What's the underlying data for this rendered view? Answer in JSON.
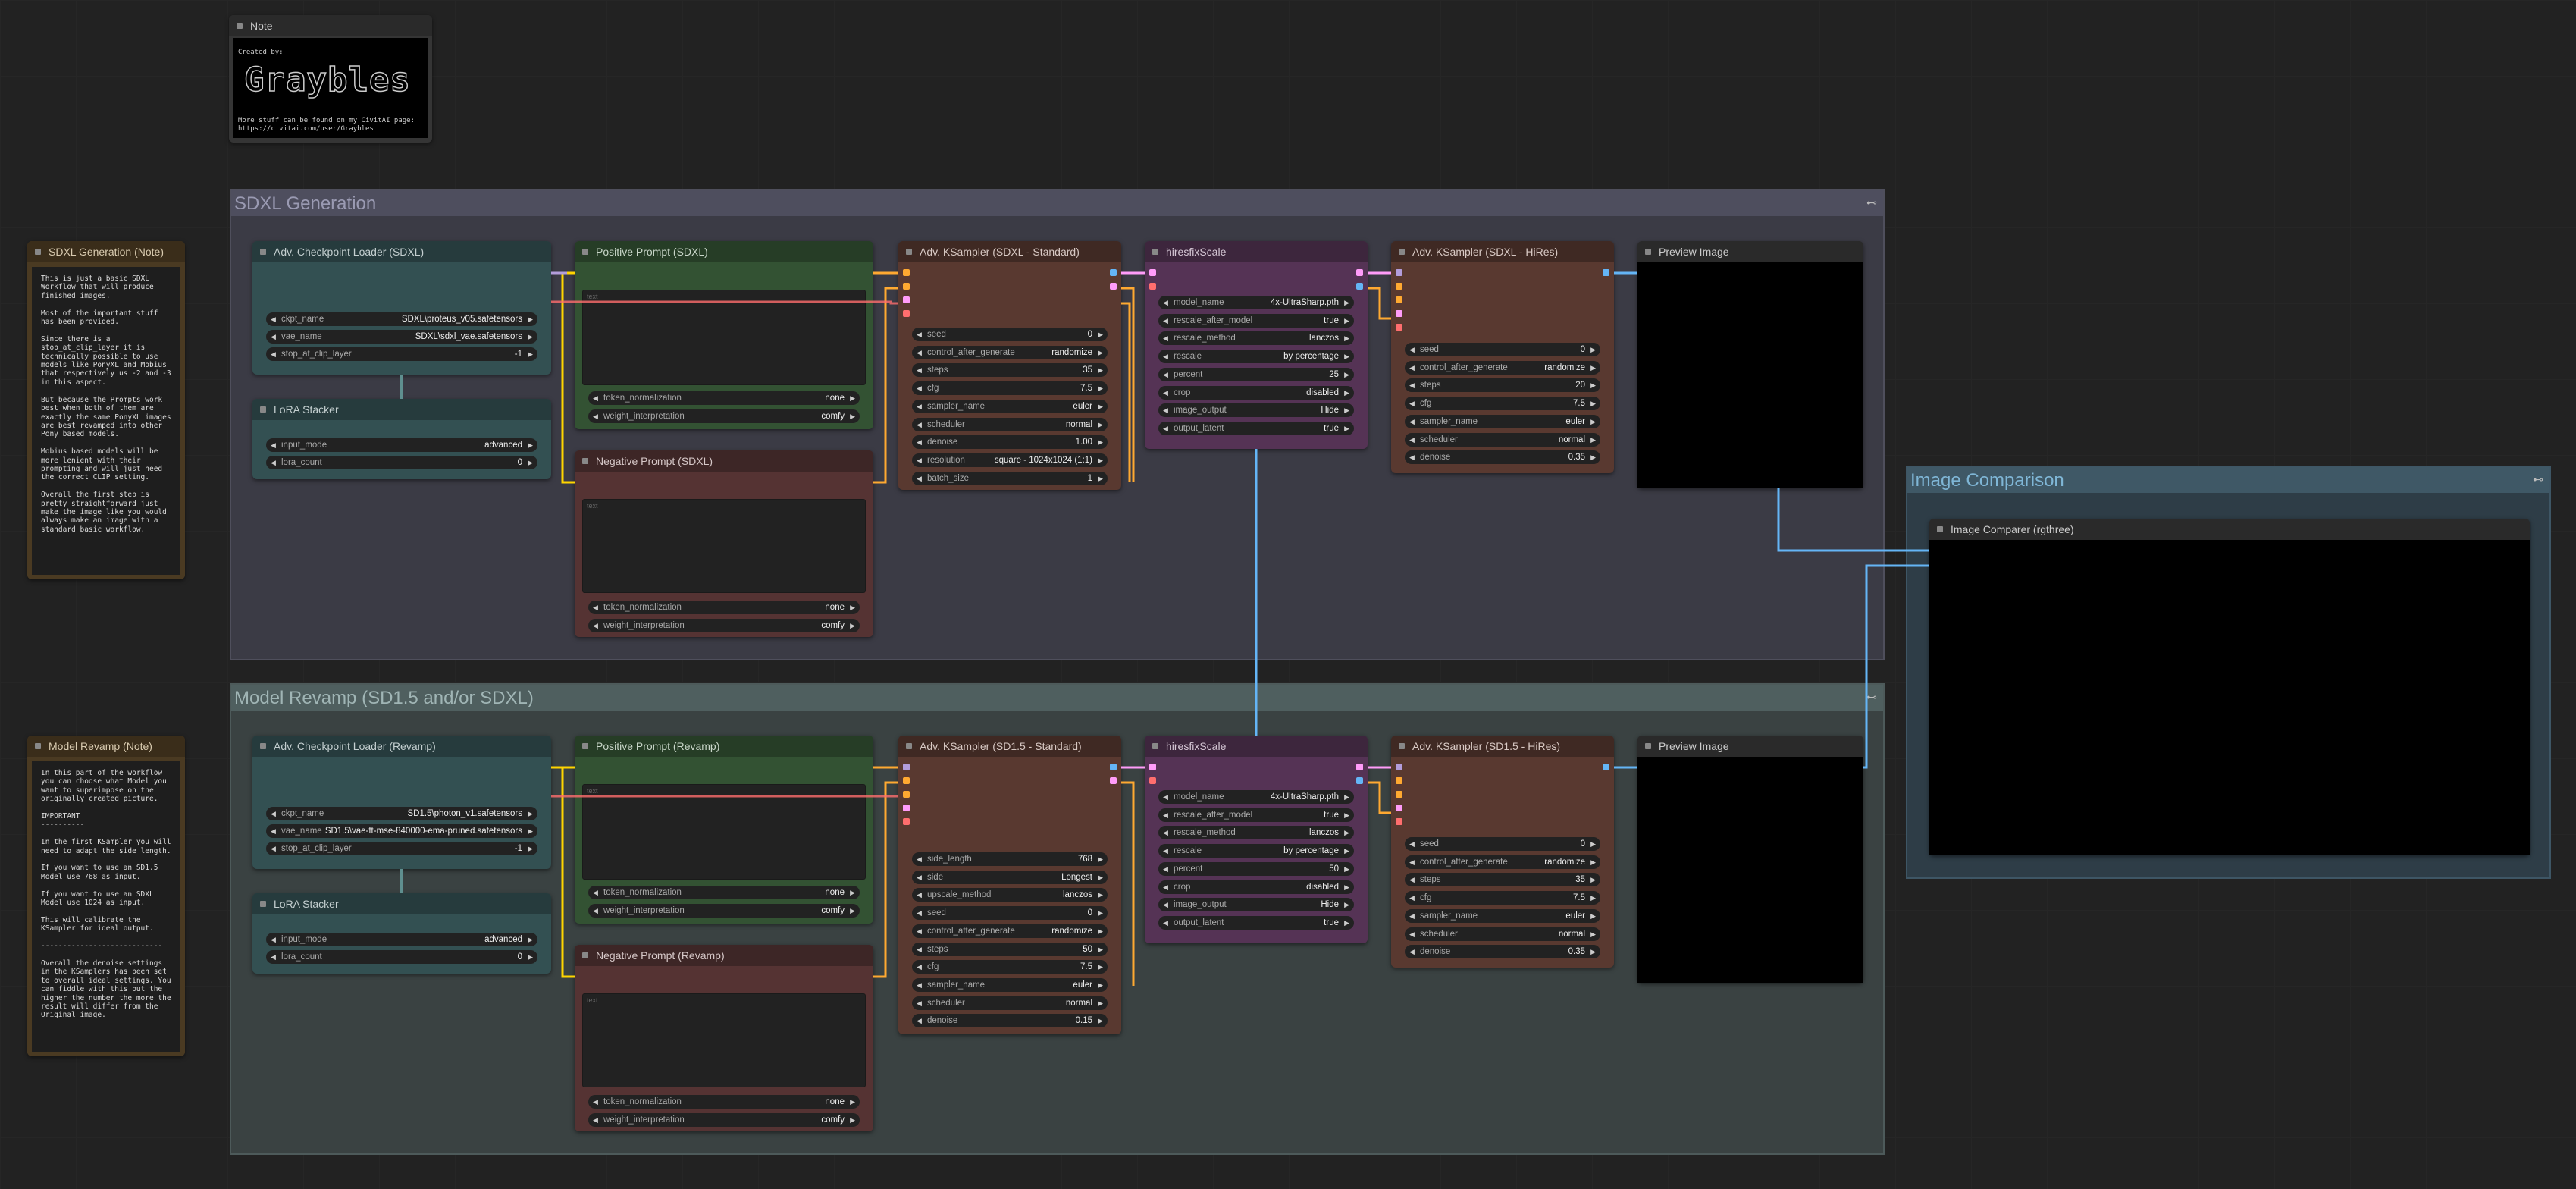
{
  "note_top": {
    "title": "Note",
    "created_by": "Created by:",
    "logo": "Graybles",
    "footer": "More stuff can be found on my CivitAI page:\nhttps://civitai.com/user/Graybles"
  },
  "groups": {
    "sdxl": "SDXL Generation",
    "revamp": "Model Revamp (SD1.5 and/or SDXL)",
    "compare": "Image Comparison"
  },
  "notes": {
    "sdxl": {
      "title": "SDXL Generation (Note)",
      "text": "This is just a basic SDXL Workflow that will produce finished images.\n\nMost of the important stuff has been provided.\n\nSince there is a stop_at_clip_layer it is technically possible to use models like PonyXL and Mobius that respectively us -2 and -3 in this aspect.\n\nBut because the Prompts work best when both of them are exactly the same PonyXL images are best revamped into other Pony based models.\n\nMobius based models will be more lenient with their prompting and will just need the correct CLIP setting.\n\nOverall the first step is pretty straightforward just make the image like you would always make an image with a standard basic workflow."
    },
    "revamp": {
      "title": "Model Revamp (Note)",
      "text": "In this part of the workflow you can choose what Model you want to superimpose on the originally created picture.\n\nIMPORTANT\n----------\n\nIn the first KSampler you will need to adapt the side_length.\n\nIf you want to use an SD1.5 Model use 768 as input.\n\nIf you want to use an SDXL Model use 1024 as input.\n\nThis will calibrate the KSampler for ideal output.\n\n----------------------------\n\nOverall the denoise settings in the KSamplers has been set to overall ideal settings. You can fiddle with this but the higher the number the more the result will differ from the Original image."
    }
  },
  "sdxl": {
    "loader": {
      "title": "Adv. Checkpoint Loader (SDXL)",
      "ckpt_k": "ckpt_name",
      "ckpt_v": "SDXL\\proteus_v05.safetensors",
      "vae_k": "vae_name",
      "vae_v": "SDXL\\sdxl_vae.safetensors",
      "clip_k": "stop_at_clip_layer",
      "clip_v": "-1"
    },
    "lora": {
      "title": "LoRA Stacker",
      "mode_k": "input_mode",
      "mode_v": "advanced",
      "count_k": "lora_count",
      "count_v": "0"
    },
    "pos": {
      "title": "Positive Prompt (SDXL)",
      "placeholder": "text",
      "tn_k": "token_normalization",
      "tn_v": "none",
      "wi_k": "weight_interpretation",
      "wi_v": "comfy"
    },
    "neg": {
      "title": "Negative Prompt (SDXL)",
      "placeholder": "text",
      "tn_k": "token_normalization",
      "tn_v": "none",
      "wi_k": "weight_interpretation",
      "wi_v": "comfy"
    },
    "ks": {
      "title": "Adv. KSampler (SDXL - Standard)",
      "rows": [
        [
          "seed",
          "0"
        ],
        [
          "control_after_generate",
          "randomize"
        ],
        [
          "steps",
          "35"
        ],
        [
          "cfg",
          "7.5"
        ],
        [
          "sampler_name",
          "euler"
        ],
        [
          "scheduler",
          "normal"
        ],
        [
          "denoise",
          "1.00"
        ],
        [
          "resolution",
          "square - 1024x1024 (1:1)"
        ],
        [
          "batch_size",
          "1"
        ]
      ]
    },
    "hires": {
      "title": "hiresfixScale",
      "rows": [
        [
          "model_name",
          "4x-UltraSharp.pth"
        ],
        [
          "rescale_after_model",
          "true"
        ],
        [
          "rescale_method",
          "lanczos"
        ],
        [
          "rescale",
          "by percentage"
        ],
        [
          "percent",
          "25"
        ],
        [
          "crop",
          "disabled"
        ],
        [
          "image_output",
          "Hide"
        ],
        [
          "output_latent",
          "true"
        ]
      ]
    },
    "ks2": {
      "title": "Adv. KSampler (SDXL - HiRes)",
      "rows": [
        [
          "seed",
          "0"
        ],
        [
          "control_after_generate",
          "randomize"
        ],
        [
          "steps",
          "20"
        ],
        [
          "cfg",
          "7.5"
        ],
        [
          "sampler_name",
          "euler"
        ],
        [
          "scheduler",
          "normal"
        ],
        [
          "denoise",
          "0.35"
        ]
      ]
    },
    "preview": {
      "title": "Preview Image"
    }
  },
  "revamp": {
    "loader": {
      "title": "Adv. Checkpoint Loader (Revamp)",
      "ckpt_k": "ckpt_name",
      "ckpt_v": "SD1.5\\photon_v1.safetensors",
      "vae_k": "vae_name",
      "vae_v": "SD1.5\\vae-ft-mse-840000-ema-pruned.safetensors",
      "clip_k": "stop_at_clip_layer",
      "clip_v": "-1"
    },
    "lora": {
      "title": "LoRA Stacker",
      "mode_k": "input_mode",
      "mode_v": "advanced",
      "count_k": "lora_count",
      "count_v": "0"
    },
    "pos": {
      "title": "Positive Prompt (Revamp)",
      "placeholder": "text",
      "tn_k": "token_normalization",
      "tn_v": "none",
      "wi_k": "weight_interpretation",
      "wi_v": "comfy"
    },
    "neg": {
      "title": "Negative Prompt (Revamp)",
      "placeholder": "text",
      "tn_k": "token_normalization",
      "tn_v": "none",
      "wi_k": "weight_interpretation",
      "wi_v": "comfy"
    },
    "ks": {
      "title": "Adv. KSampler (SD1.5 - Standard)",
      "rows": [
        [
          "side_length",
          "768"
        ],
        [
          "side",
          "Longest"
        ],
        [
          "upscale_method",
          "lanczos"
        ],
        [
          "seed",
          "0"
        ],
        [
          "control_after_generate",
          "randomize"
        ],
        [
          "steps",
          "50"
        ],
        [
          "cfg",
          "7.5"
        ],
        [
          "sampler_name",
          "euler"
        ],
        [
          "scheduler",
          "normal"
        ],
        [
          "denoise",
          "0.15"
        ]
      ]
    },
    "hires": {
      "title": "hiresfixScale",
      "rows": [
        [
          "model_name",
          "4x-UltraSharp.pth"
        ],
        [
          "rescale_after_model",
          "true"
        ],
        [
          "rescale_method",
          "lanczos"
        ],
        [
          "rescale",
          "by percentage"
        ],
        [
          "percent",
          "50"
        ],
        [
          "crop",
          "disabled"
        ],
        [
          "image_output",
          "Hide"
        ],
        [
          "output_latent",
          "true"
        ]
      ]
    },
    "ks2": {
      "title": "Adv. KSampler (SD1.5 - HiRes)",
      "rows": [
        [
          "seed",
          "0"
        ],
        [
          "control_after_generate",
          "randomize"
        ],
        [
          "steps",
          "35"
        ],
        [
          "cfg",
          "7.5"
        ],
        [
          "sampler_name",
          "euler"
        ],
        [
          "scheduler",
          "normal"
        ],
        [
          "denoise",
          "0.35"
        ]
      ]
    },
    "preview": {
      "title": "Preview Image"
    }
  },
  "compare": {
    "title": "Image Comparer (rgthree)"
  },
  "colors": {
    "model": "#b39ddb",
    "clip": "#ffd500",
    "vae": "#ff6e6e",
    "conditioning": "#ffa931",
    "latent": "#ff9cf9",
    "image": "#64b5f6"
  }
}
